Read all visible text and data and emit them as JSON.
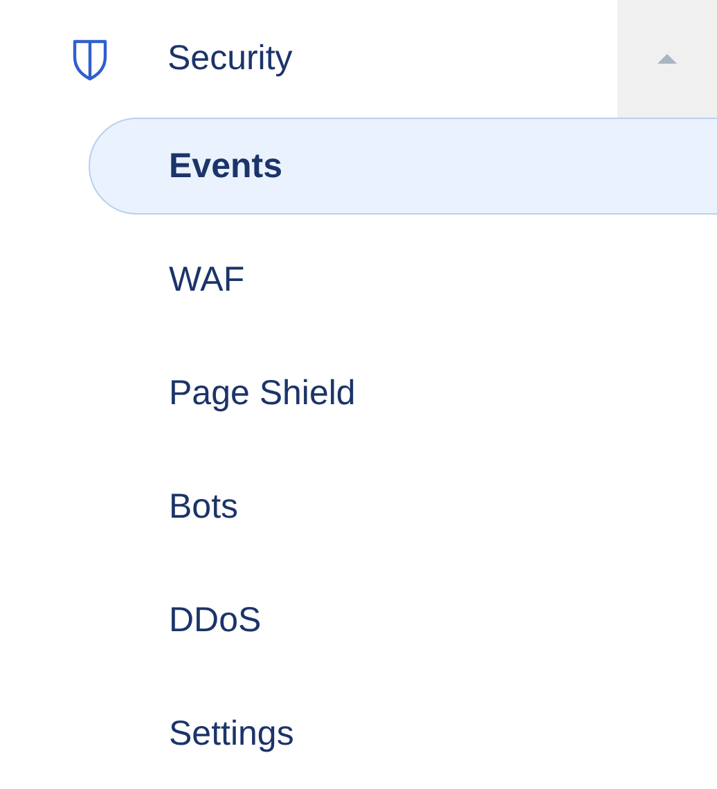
{
  "section": {
    "label": "Security",
    "expanded": true
  },
  "items": [
    {
      "label": "Events",
      "selected": true
    },
    {
      "label": "WAF",
      "selected": false
    },
    {
      "label": "Page Shield",
      "selected": false
    },
    {
      "label": "Bots",
      "selected": false
    },
    {
      "label": "DDoS",
      "selected": false
    },
    {
      "label": "Settings",
      "selected": false
    }
  ]
}
